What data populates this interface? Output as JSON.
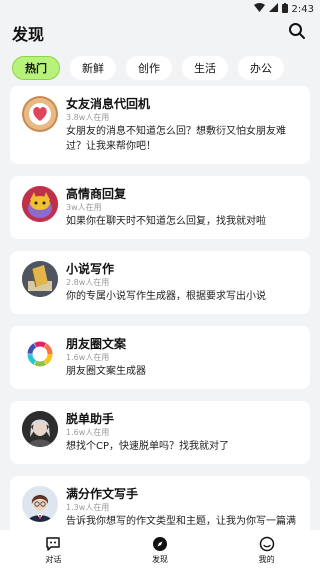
{
  "status": {
    "time": "2:43"
  },
  "header": {
    "title": "发现"
  },
  "tabs": [
    {
      "label": "热门",
      "active": true
    },
    {
      "label": "新鲜",
      "active": false
    },
    {
      "label": "创作",
      "active": false
    },
    {
      "label": "生活",
      "active": false
    },
    {
      "label": "办公",
      "active": false
    }
  ],
  "cards": [
    {
      "title": "女友消息代回机",
      "users": "3.8w人在用",
      "desc": "女朋友的消息不知道怎么回？想敷衍又怕女朋友难过？让我来帮你吧！",
      "icon": "heart-icon"
    },
    {
      "title": "高情商回复",
      "users": "3w人在用",
      "desc": "如果你在聊天时不知道怎么回复，找我就对啦",
      "icon": "cat-icon"
    },
    {
      "title": "小说写作",
      "users": "2.8w人在用",
      "desc": "你的专属小说写作生成器，根据要求写出小说",
      "icon": "book-icon"
    },
    {
      "title": "朋友圈文案",
      "users": "1.6w人在用",
      "desc": "朋友圈文案生成器",
      "icon": "ring-icon"
    },
    {
      "title": "脱单助手",
      "users": "1.6w人在用",
      "desc": "想找个CP，快速脱单吗？找我就对了",
      "icon": "portrait-icon"
    },
    {
      "title": "满分作文写手",
      "users": "1.3w人在用",
      "desc": "告诉我你想写的作文类型和主题，让我为你写一篇满分作文",
      "icon": "student-icon"
    }
  ],
  "bottomnav": {
    "chat": "对话",
    "discover": "发现",
    "mine": "我的"
  }
}
